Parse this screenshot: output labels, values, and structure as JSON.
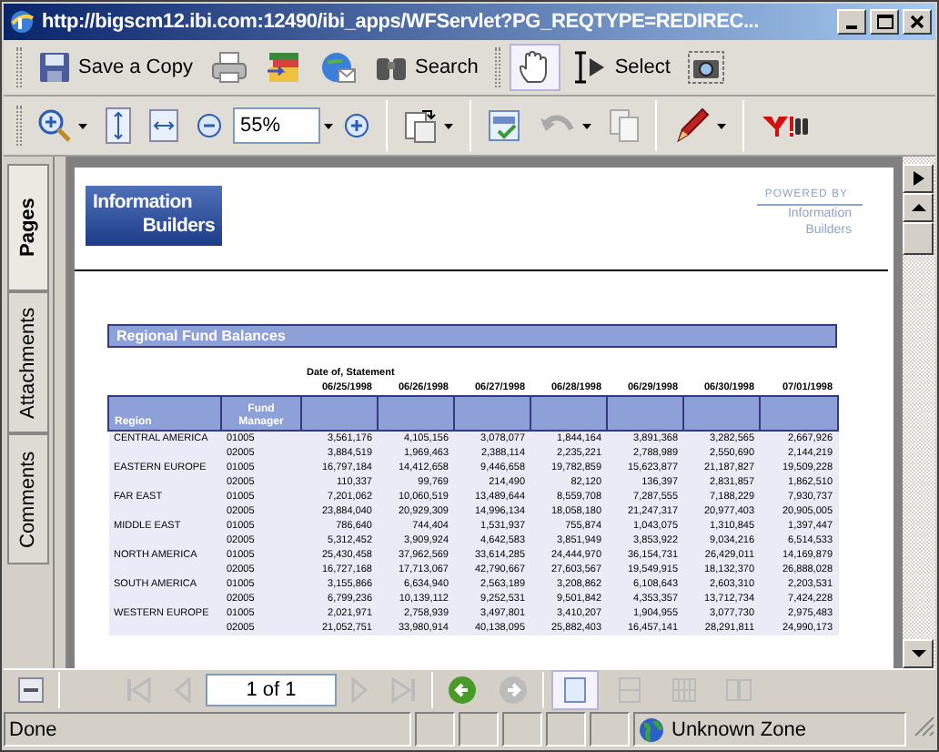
{
  "window": {
    "title": "http://bigscm12.ibi.com:12490/ibi_apps/WFServlet?PG_REQTYPE=REDIREC..."
  },
  "toolbar": {
    "save_label": "Save a Copy",
    "search_label": "Search",
    "hand_tool_selected": true,
    "select_label": "Select",
    "zoom": "55%"
  },
  "side_tabs": [
    {
      "label": "Pages",
      "selected": true
    },
    {
      "label": "Attachments",
      "selected": false
    },
    {
      "label": "Comments",
      "selected": false
    }
  ],
  "document": {
    "logo": [
      "Information",
      "Builders"
    ],
    "powered_by": [
      "POWERED BY",
      "Information",
      "Builders"
    ],
    "report_title": "Regional Fund Balances",
    "date_caption": "Date of, Statement",
    "columns": [
      "Region",
      "Fund Manager"
    ],
    "dates": [
      "06/25/1998",
      "06/26/1998",
      "06/27/1998",
      "06/28/1998",
      "06/29/1998",
      "06/30/1998",
      "07/01/1998"
    ],
    "rows": [
      {
        "region": "CENTRAL AMERICA",
        "manager": "01005",
        "values": [
          "3,561,176",
          "4,105,156",
          "3,078,077",
          "1,844,164",
          "3,891,368",
          "3,282,565",
          "2,667,926"
        ]
      },
      {
        "manager": "02005",
        "values": [
          "3,884,519",
          "1,969,463",
          "2,388,114",
          "2,235,221",
          "2,788,989",
          "2,550,690",
          "2,144,219"
        ]
      },
      {
        "region": "EASTERN EUROPE",
        "manager": "01005",
        "values": [
          "16,797,184",
          "14,412,658",
          "9,446,658",
          "19,782,859",
          "15,623,877",
          "21,187,827",
          "19,509,228"
        ]
      },
      {
        "manager": "02005",
        "values": [
          "110,337",
          "99,769",
          "214,490",
          "82,120",
          "136,397",
          "2,831,857",
          "1,862,510"
        ]
      },
      {
        "region": "FAR EAST",
        "manager": "01005",
        "values": [
          "7,201,062",
          "10,060,519",
          "13,489,644",
          "8,559,708",
          "7,287,555",
          "7,188,229",
          "7,930,737"
        ]
      },
      {
        "manager": "02005",
        "values": [
          "23,884,040",
          "20,929,309",
          "14,996,134",
          "18,058,180",
          "21,247,317",
          "20,977,403",
          "20,905,005"
        ]
      },
      {
        "region": "MIDDLE EAST",
        "manager": "01005",
        "values": [
          "786,640",
          "744,404",
          "1,531,937",
          "755,874",
          "1,043,075",
          "1,310,845",
          "1,397,447"
        ]
      },
      {
        "manager": "02005",
        "values": [
          "5,312,452",
          "3,909,924",
          "4,642,583",
          "3,851,949",
          "3,853,922",
          "9,034,216",
          "6,514,533"
        ]
      },
      {
        "region": "NORTH AMERICA",
        "manager": "01005",
        "values": [
          "25,430,458",
          "37,962,569",
          "33,614,285",
          "24,444,970",
          "36,154,731",
          "26,429,011",
          "14,169,879"
        ]
      },
      {
        "manager": "02005",
        "values": [
          "16,727,168",
          "17,713,067",
          "42,790,667",
          "27,603,567",
          "19,549,915",
          "18,132,370",
          "26,888,028"
        ]
      },
      {
        "region": "SOUTH AMERICA",
        "manager": "01005",
        "values": [
          "3,155,866",
          "6,634,940",
          "2,563,189",
          "3,208,862",
          "6,108,643",
          "2,603,310",
          "2,203,531"
        ]
      },
      {
        "manager": "02005",
        "values": [
          "6,799,236",
          "10,139,112",
          "9,252,531",
          "9,501,842",
          "4,353,357",
          "13,712,734",
          "7,424,228"
        ]
      },
      {
        "region": "WESTERN EUROPE",
        "manager": "01005",
        "values": [
          "2,021,971",
          "2,758,939",
          "3,497,801",
          "3,410,207",
          "1,904,955",
          "3,077,730",
          "2,975,483"
        ]
      },
      {
        "manager": "02005",
        "values": [
          "21,052,751",
          "33,980,914",
          "40,138,095",
          "25,882,403",
          "16,457,141",
          "28,291,811",
          "24,990,173"
        ]
      }
    ]
  },
  "navigation": {
    "page": "1 of 1",
    "views": [
      {
        "selected": true
      },
      {
        "selected": false
      },
      {
        "selected": false
      },
      {
        "selected": false
      }
    ]
  },
  "status_bar": {
    "text": "Done",
    "zone": "Unknown Zone"
  }
}
